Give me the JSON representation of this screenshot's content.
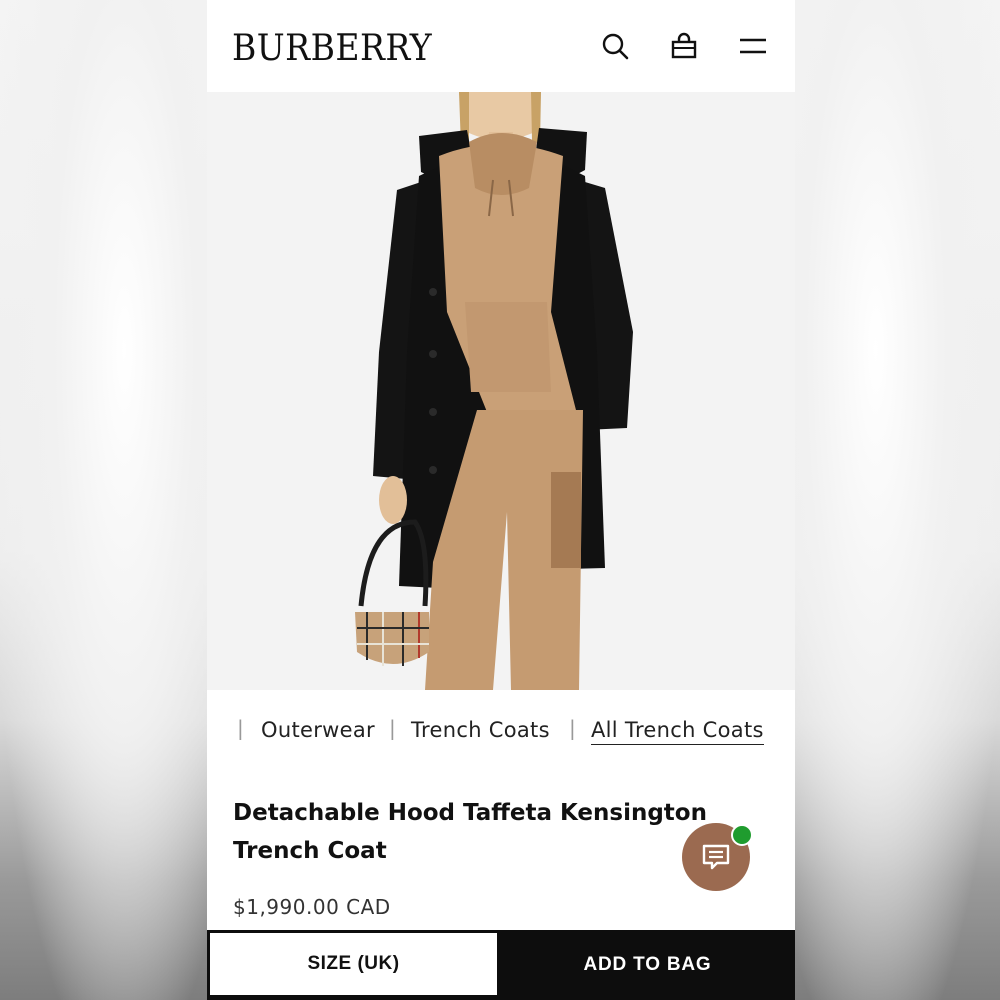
{
  "header": {
    "logo": "BURBERRY",
    "icons": [
      "search-icon",
      "shopping-bag-icon",
      "menu-icon"
    ]
  },
  "hero": {
    "colors": {
      "background": "#f3f3f3",
      "coat": "#111111",
      "hoodie": "#c9a077",
      "trousers": "#c59b71"
    }
  },
  "breadcrumb": {
    "items": [
      "Outerwear",
      "Trench Coats",
      "All Trench Coats"
    ]
  },
  "product": {
    "title_line1": "Detachable Hood Taffeta Kensington",
    "title_line2": "Trench Coat",
    "price": "$1,990.00 CAD"
  },
  "chat": {
    "icon": "chat-icon",
    "status_color": "#1f9c2e",
    "button_color": "#9b6a50"
  },
  "actions": {
    "size_label": "SIZE (UK)",
    "add_label": "ADD TO BAG"
  }
}
